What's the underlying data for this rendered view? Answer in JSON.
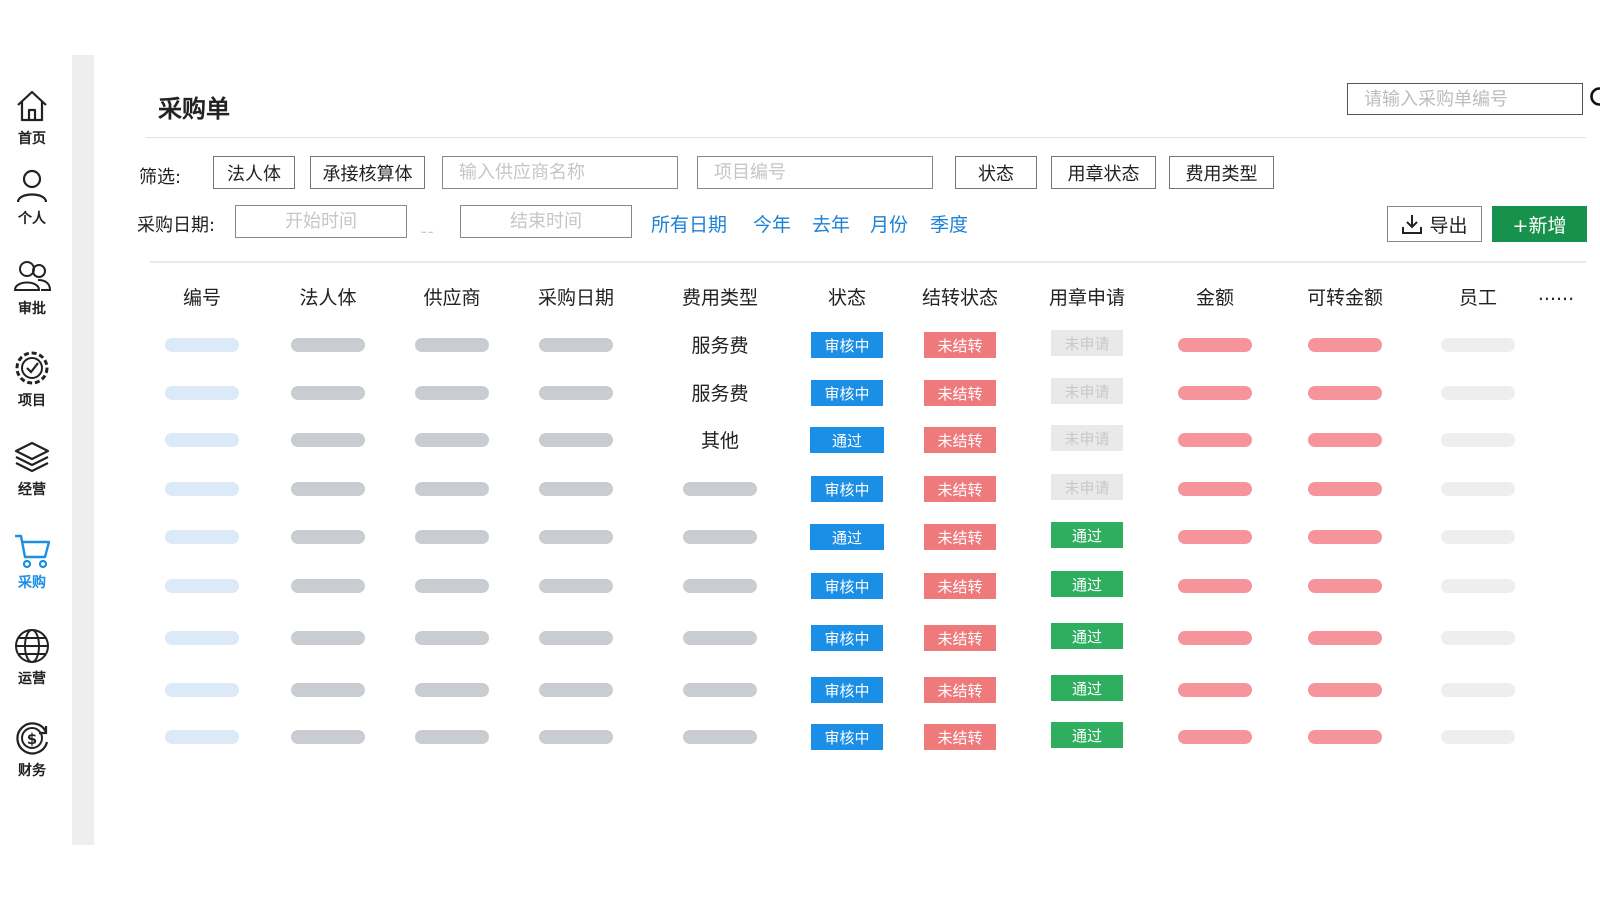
{
  "sidebar": {
    "items": [
      {
        "label": "首页",
        "icon": "home-icon"
      },
      {
        "label": "个人",
        "icon": "user-icon"
      },
      {
        "label": "审批",
        "icon": "users-icon"
      },
      {
        "label": "项目",
        "icon": "gear-badge-icon"
      },
      {
        "label": "经营",
        "icon": "layers-icon"
      },
      {
        "label": "采购",
        "icon": "cart-icon",
        "active": true
      },
      {
        "label": "运营",
        "icon": "globe-icon"
      },
      {
        "label": "财务",
        "icon": "dollar-cycle-icon"
      }
    ],
    "active_color": "#1b8fe6"
  },
  "header": {
    "title": "采购单",
    "search_placeholder": "请输入采购单编号"
  },
  "filters": {
    "label": "筛选:",
    "legal_entity_btn": "法人体",
    "accounting_entity_btn": "承接核算体",
    "supplier_placeholder": "输入供应商名称",
    "project_placeholder": "项目编号",
    "status_btn": "状态",
    "seal_status_btn": "用章状态",
    "fee_type_btn": "费用类型",
    "date_label": "采购日期:",
    "start_placeholder": "开始时间",
    "date_separator": "--",
    "end_placeholder": "结束时间",
    "date_links": [
      "所有日期",
      "今年",
      "去年",
      "月份",
      "季度"
    ],
    "export_label": "导出",
    "add_label": "+新增"
  },
  "table": {
    "headers": [
      "编号",
      "法人体",
      "供应商",
      "采购日期",
      "费用类型",
      "状态",
      "结转状态",
      "用章申请",
      "金额",
      "可转金额",
      "员工",
      "......"
    ],
    "rows": [
      {
        "fee_type": "服务费",
        "status": "审核中",
        "carry": "未结转",
        "seal": "未申请"
      },
      {
        "fee_type": "服务费",
        "status": "审核中",
        "carry": "未结转",
        "seal": "未申请"
      },
      {
        "fee_type": "其他",
        "status": "通过",
        "carry": "未结转",
        "seal": "未申请"
      },
      {
        "fee_type": "",
        "status": "审核中",
        "carry": "未结转",
        "seal": "未申请"
      },
      {
        "fee_type": "",
        "status": "通过",
        "carry": "未结转",
        "seal": "通过"
      },
      {
        "fee_type": "",
        "status": "审核中",
        "carry": "未结转",
        "seal": "通过"
      },
      {
        "fee_type": "",
        "status": "审核中",
        "carry": "未结转",
        "seal": "通过"
      },
      {
        "fee_type": "",
        "status": "审核中",
        "carry": "未结转",
        "seal": "通过"
      },
      {
        "fee_type": "",
        "status": "审核中",
        "carry": "未结转",
        "seal": "通过"
      }
    ]
  },
  "colors": {
    "status_blue": "#1b8fe6",
    "carry_red": "#ef7a7c",
    "seal_green": "#2fae60",
    "seal_pending": "#e9e9e9",
    "add_button": "#17924c",
    "link_blue": "#1b82d8"
  }
}
